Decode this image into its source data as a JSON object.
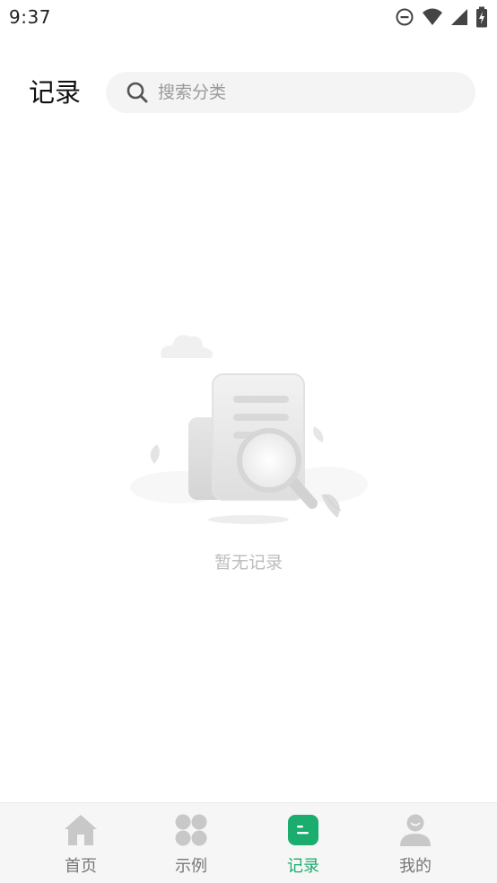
{
  "status_bar": {
    "time": "9:37",
    "icons": [
      "do-not-disturb-icon",
      "wifi-icon",
      "signal-icon",
      "battery-charging-icon"
    ]
  },
  "header": {
    "title": "记录",
    "search": {
      "placeholder": "搜索分类",
      "value": "",
      "icon": "search-icon"
    }
  },
  "empty_state": {
    "message": "暂无记录",
    "illustration": "document-magnifier-illustration"
  },
  "bottom_nav": {
    "active_index": 2,
    "active_color": "#1aad6e",
    "inactive_color": "#c8c8c8",
    "items": [
      {
        "label": "首页",
        "icon": "home-icon"
      },
      {
        "label": "示例",
        "icon": "grid-icon"
      },
      {
        "label": "记录",
        "icon": "records-icon"
      },
      {
        "label": "我的",
        "icon": "profile-icon"
      }
    ]
  }
}
